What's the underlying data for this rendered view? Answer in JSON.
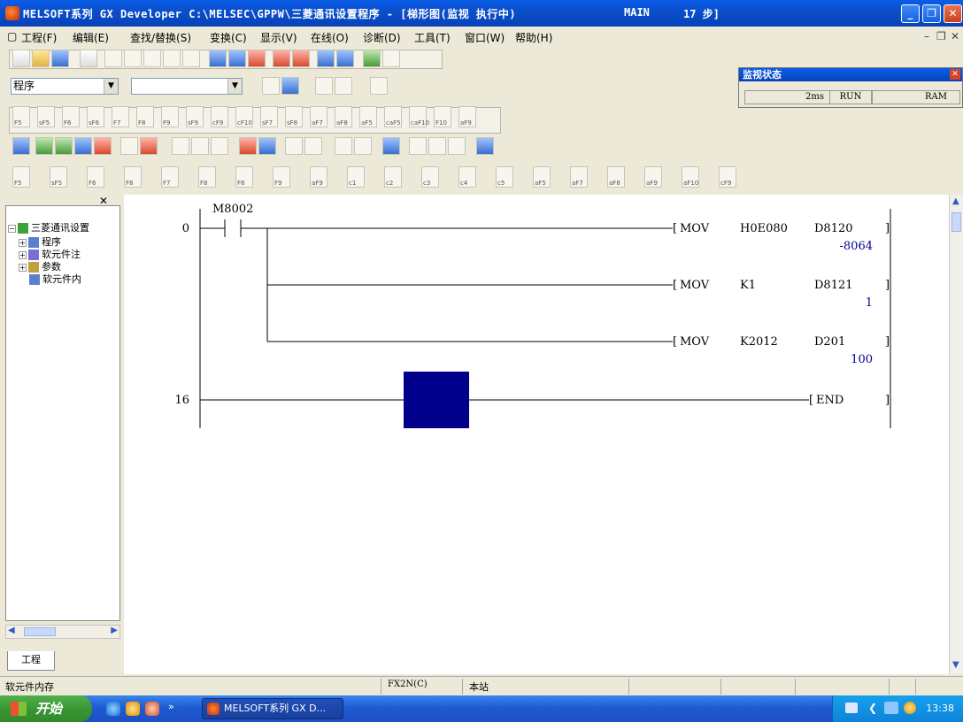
{
  "window": {
    "title": "MELSOFT系列 GX Developer C:\\MELSEC\\GPPW\\三菱通讯设置程序 - [梯形图(监视 执行中)",
    "main_label": "MAIN",
    "steps_label": "17 步]"
  },
  "menu": {
    "items": [
      "工程(F)",
      "编辑(E)",
      "查找/替换(S)",
      "变换(C)",
      "显示(V)",
      "在线(O)",
      "诊断(D)",
      "工具(T)",
      "窗口(W)",
      "帮助(H)"
    ]
  },
  "toolbar": {
    "program_combo": "程序",
    "second_combo": "",
    "fkeys_row1": [
      "F5",
      "sF5",
      "F6",
      "sF6",
      "F7",
      "F8",
      "F9",
      "sF9",
      "cF9",
      "cF10",
      "sF7",
      "sF8",
      "aF7",
      "aF8",
      "aF5",
      "caF5",
      "caF10",
      "F10",
      "aF9"
    ],
    "fkeys_row4": [
      "F5",
      "sF5",
      "F6",
      "F8",
      "F7",
      "F8",
      "F8",
      "F9",
      "aF9",
      "c1",
      "c2",
      "c3",
      "c4",
      "c5",
      "aF5",
      "aF7",
      "aF8",
      "aF9",
      "aF10",
      "cF9"
    ]
  },
  "monitor_status": {
    "title": "监视状态",
    "scan_time": "2ms",
    "run_state": "RUN",
    "memory": "RAM"
  },
  "project_tree": {
    "root": "三菱通讯设置",
    "items": [
      "程序",
      "软元件注",
      "参数",
      "软元件内"
    ],
    "tab_label": "工程"
  },
  "ladder": {
    "contact_label": "M8002",
    "rungs": [
      {
        "step": "0",
        "instr": "MOV",
        "src": "H0E080",
        "dst": "D8120",
        "monitor": "-8064"
      },
      {
        "step": "",
        "instr": "MOV",
        "src": "K1",
        "dst": "D8121",
        "monitor": "1"
      },
      {
        "step": "",
        "instr": "MOV",
        "src": "K2012",
        "dst": "D201",
        "monitor": "100"
      },
      {
        "step": "16",
        "instr": "END",
        "src": "",
        "dst": "",
        "monitor": ""
      }
    ]
  },
  "statusbar": {
    "left": "软元件内存",
    "plc": "FX2N(C)",
    "station": "本站"
  },
  "taskbar": {
    "start": "开始",
    "task": "MELSOFT系列 GX D...",
    "clock": "13:38"
  },
  "colors": {
    "titlebar": "#0b4fcc",
    "cursor_block": "#00008b",
    "monitor_value": "#00008b"
  }
}
